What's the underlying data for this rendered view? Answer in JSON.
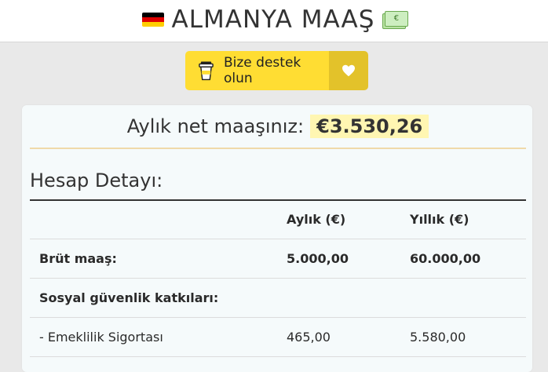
{
  "header": {
    "title": "ALMANYA MAAŞ",
    "left_icon": "germany-flag-icon",
    "right_icon": "money-icon"
  },
  "support_button": {
    "label": "Bize destek olun",
    "icon": "cup-icon",
    "heart_icon": "heart-icon",
    "colors": {
      "main": "#ffdd33",
      "heart_bg": "#e3c22a"
    }
  },
  "net_salary": {
    "label": "Aylık net maaşınız:",
    "value": "€3.530,26"
  },
  "details": {
    "title": "Hesap Detayı:",
    "columns": [
      "",
      "Aylık (€)",
      "Yıllık (€)"
    ],
    "rows": [
      {
        "label": "Brüt maaş:",
        "monthly": "5.000,00",
        "yearly": "60.000,00"
      },
      {
        "label": "Sosyal güvenlik katkıları:",
        "monthly": "",
        "yearly": ""
      },
      {
        "label": "- Emeklilik Sigortası",
        "monthly": "465,00",
        "yearly": "5.580,00"
      }
    ]
  }
}
